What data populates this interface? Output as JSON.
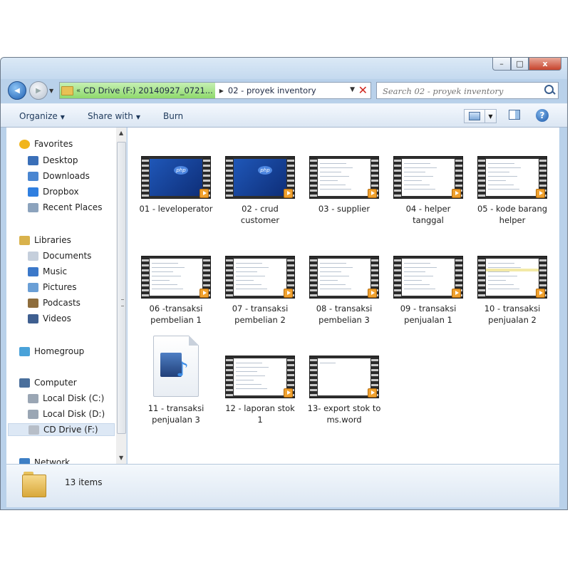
{
  "window": {
    "controls": {
      "minimize": "–",
      "maximize": "□",
      "close": "x"
    }
  },
  "nav": {
    "back_glyph": "◀",
    "forward_glyph": "▶",
    "dropdown_glyph": "▼"
  },
  "address": {
    "breadcrumb_arrow": "«",
    "crumb1": "CD Drive (F:) 20140927_0721...",
    "separator": "▶",
    "crumb2": "02 - proyek inventory",
    "dropdown": "▼",
    "clear": "✕"
  },
  "search": {
    "placeholder": "Search 02 - proyek inventory"
  },
  "toolbar": {
    "organize": "Organize",
    "share_with": "Share with",
    "burn": "Burn",
    "help": "?"
  },
  "sidebar": {
    "items": [
      {
        "label": "Favorites",
        "icon": "star-icon",
        "group": true
      },
      {
        "label": "Desktop",
        "icon": "desktop-icon"
      },
      {
        "label": "Downloads",
        "icon": "downloads-icon"
      },
      {
        "label": "Dropbox",
        "icon": "dropbox-icon"
      },
      {
        "label": "Recent Places",
        "icon": "recent-places-icon"
      },
      {
        "label": "Libraries",
        "icon": "libraries-icon",
        "group": true
      },
      {
        "label": "Documents",
        "icon": "documents-icon"
      },
      {
        "label": "Music",
        "icon": "music-icon"
      },
      {
        "label": "Pictures",
        "icon": "pictures-icon"
      },
      {
        "label": "Podcasts",
        "icon": "podcasts-icon"
      },
      {
        "label": "Videos",
        "icon": "videos-icon"
      },
      {
        "label": "Homegroup",
        "icon": "homegroup-icon",
        "group": true
      },
      {
        "label": "Computer",
        "icon": "computer-icon",
        "group": true
      },
      {
        "label": "Local Disk (C:)",
        "icon": "local-disk-icon"
      },
      {
        "label": "Local Disk (D:)",
        "icon": "local-disk-icon"
      },
      {
        "label": "CD Drive (F:)",
        "icon": "cd-drive-icon",
        "selected": true
      },
      {
        "label": "Network",
        "icon": "network-icon",
        "group": true
      }
    ]
  },
  "files": [
    {
      "name": "01 - leveloperator",
      "thumb": "php"
    },
    {
      "name": "02 - crud customer",
      "thumb": "php"
    },
    {
      "name": "03 - supplier",
      "thumb": "screen"
    },
    {
      "name": "04 - helper tanggal",
      "thumb": "screen"
    },
    {
      "name": "05 - kode barang helper",
      "thumb": "screen"
    },
    {
      "name": "06 -transaksi pembelian 1",
      "thumb": "screen"
    },
    {
      "name": "07 - transaksi pembelian 2",
      "thumb": "screen"
    },
    {
      "name": "08 - transaksi pembelian 3",
      "thumb": "screen"
    },
    {
      "name": "09 - transaksi penjualan 1",
      "thumb": "screen"
    },
    {
      "name": "10 - transaksi penjualan 2",
      "thumb": "screen-hl"
    },
    {
      "name": "11 - transaksi penjualan 3",
      "thumb": "media-file"
    },
    {
      "name": "12 - laporan stok 1",
      "thumb": "screen"
    },
    {
      "name": "13- export stok to ms.word",
      "thumb": "screen-blank"
    }
  ],
  "php_logo": "php",
  "status": {
    "item_count": "13 items"
  },
  "colors": {
    "accent": "#1f5fb1",
    "address_green": "#8ed96b",
    "close_red": "#c7432c"
  }
}
